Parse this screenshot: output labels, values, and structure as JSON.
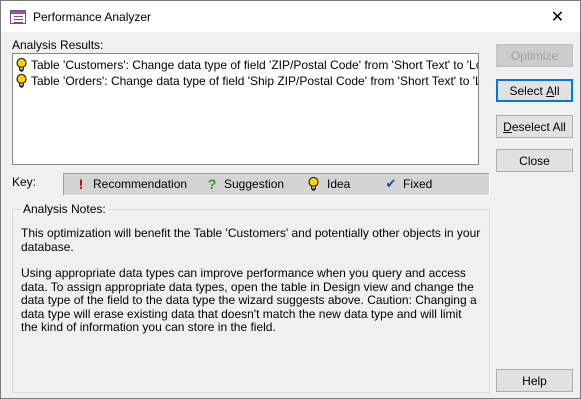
{
  "window": {
    "title": "Performance Analyzer",
    "close_glyph": "✕"
  },
  "results": {
    "label": "Analysis Results:",
    "items": [
      {
        "icon": "idea-bulb-icon",
        "text": "Table 'Customers': Change data type of field 'ZIP/Postal Code' from 'Short Text' to 'Long"
      },
      {
        "icon": "idea-bulb-icon",
        "text": "Table 'Orders': Change data type of field 'Ship ZIP/Postal Code' from 'Short Text' to 'Lon"
      }
    ]
  },
  "buttons": {
    "optimize": "Optimize",
    "select_all_pre": "Select ",
    "select_all_u": "A",
    "select_all_post": "ll",
    "deselect_all_u": "D",
    "deselect_all_post": "eselect All",
    "close": "Close",
    "help": "Help"
  },
  "key": {
    "label": "Key:",
    "items": [
      {
        "icon": "recommendation-icon",
        "label": "Recommendation",
        "glyph": "!"
      },
      {
        "icon": "suggestion-icon",
        "label": "Suggestion",
        "glyph": "?"
      },
      {
        "icon": "idea-bulb-icon",
        "label": "Idea"
      },
      {
        "icon": "fixed-checkmark-icon",
        "label": "Fixed",
        "glyph": "✔"
      }
    ]
  },
  "notes": {
    "label": "Analysis Notes:",
    "paragraphs": [
      "This optimization will benefit the Table 'Customers' and potentially other objects in your database.",
      "Using appropriate data types can improve performance when you query and access data. To assign appropriate data types, open the table in Design view and change the data type of the field to the data type the wizard suggests above. Caution: Changing a data type will erase existing data that doesn't match the new data type and will limit the kind of information you can store in the field."
    ]
  },
  "colors": {
    "bulb": "#ffd200",
    "recommendation": "#c00000",
    "suggestion": "#3a9a2a",
    "fixed": "#1b3fbf",
    "default_button_border": "#0078d7"
  }
}
